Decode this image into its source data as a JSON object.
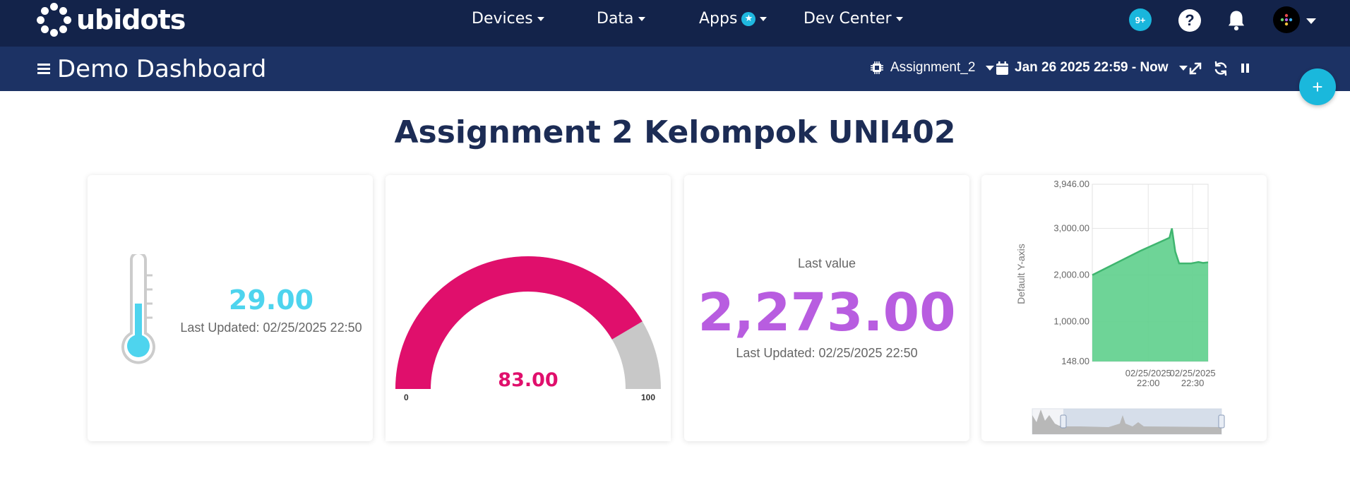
{
  "brand": {
    "name": "ubidots"
  },
  "nav": {
    "devices": "Devices",
    "data": "Data",
    "apps": "Apps",
    "dev_center": "Dev Center",
    "notifications_count": "9+",
    "help_label": "?"
  },
  "toolbar": {
    "dashboard_title": "Demo Dashboard",
    "device_selector": "Assignment_2",
    "date_range": "Jan 26 2025 22:59 - Now",
    "add_label": "+"
  },
  "page": {
    "heading": "Assignment 2 Kelompok UNI402"
  },
  "widgets": {
    "thermometer": {
      "value": "29.00",
      "updated": "Last Updated: 02/25/2025 22:50",
      "color": "#4ed4ee",
      "level": 0.5
    },
    "gauge": {
      "value": "83.00",
      "numeric": 83,
      "min": "0",
      "max": "100",
      "color": "#e00f6c"
    },
    "metric": {
      "label": "Last value",
      "value": "2,273.00",
      "updated": "Last Updated: 02/25/2025 22:50",
      "color": "#b85de0"
    }
  },
  "chart_data": {
    "type": "area",
    "ylabel": "Default Y-axis",
    "ylim": [
      148,
      3946
    ],
    "ytick_labels": [
      "3,946.00",
      "3,000.00",
      "2,000.00",
      "1,000.00",
      "148.00"
    ],
    "yticks": [
      3946,
      3000,
      2000,
      1000,
      148
    ],
    "xtick_labels": [
      [
        "02/25/2025",
        "22:00"
      ],
      [
        "02/25/2025",
        "22:30"
      ]
    ],
    "x": [
      0,
      1,
      1.6,
      1.65,
      1.72,
      1.8,
      2.05,
      2.2,
      2.3,
      2.4
    ],
    "values": [
      2000,
      2520,
      2800,
      3000,
      2500,
      2250,
      2250,
      2280,
      2260,
      2273
    ],
    "color": "#5ecf8c"
  }
}
